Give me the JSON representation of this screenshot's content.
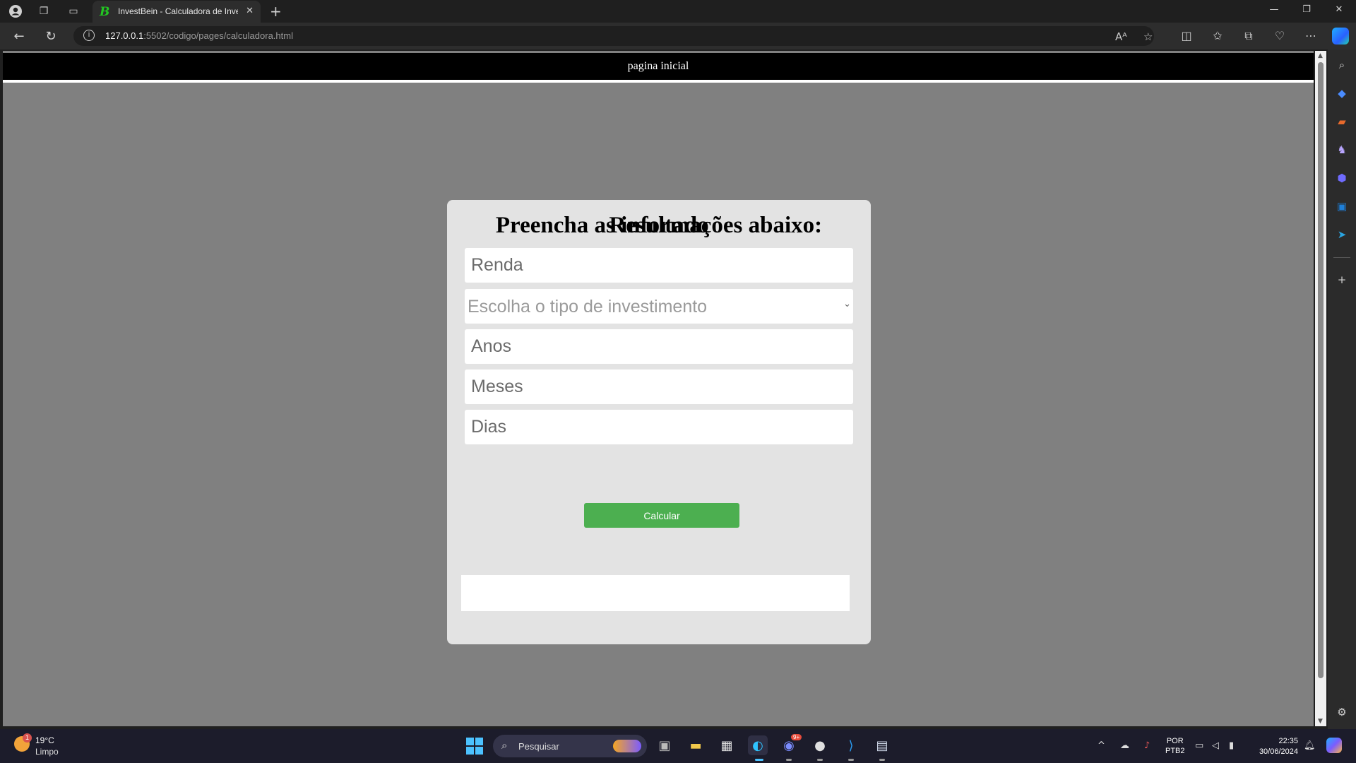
{
  "browser": {
    "tab_title": "InvestBein - Calculadora de Investimentos",
    "tab_favicon": "B",
    "url_host": "127.0.0.1",
    "url_rest": ":5502/codigo/pages/calculadora.html"
  },
  "page": {
    "nav_link": "pagina inicial",
    "form_title": "Preencha as informações abaixo:",
    "fields": {
      "renda_placeholder": "Renda",
      "investment_select": "Escolha o tipo de investimento",
      "anos_placeholder": "Anos",
      "meses_placeholder": "Meses",
      "dias_placeholder": "Dias"
    },
    "calc_button": "Calcular",
    "result_title": "Resultado",
    "result_value": ""
  },
  "taskbar": {
    "weather_temp": "19°C",
    "weather_cond": "Limpo",
    "weather_badge": "1",
    "search_label": "Pesquisar",
    "discord_badge": "9+",
    "lang_top": "POR",
    "lang_bottom": "PTB2",
    "time": "22:35",
    "date": "30/06/2024"
  },
  "colors": {
    "page_bg": "#808080",
    "card_bg": "#e3e3e3",
    "button_green": "#4caf50",
    "header_black": "#000000"
  }
}
